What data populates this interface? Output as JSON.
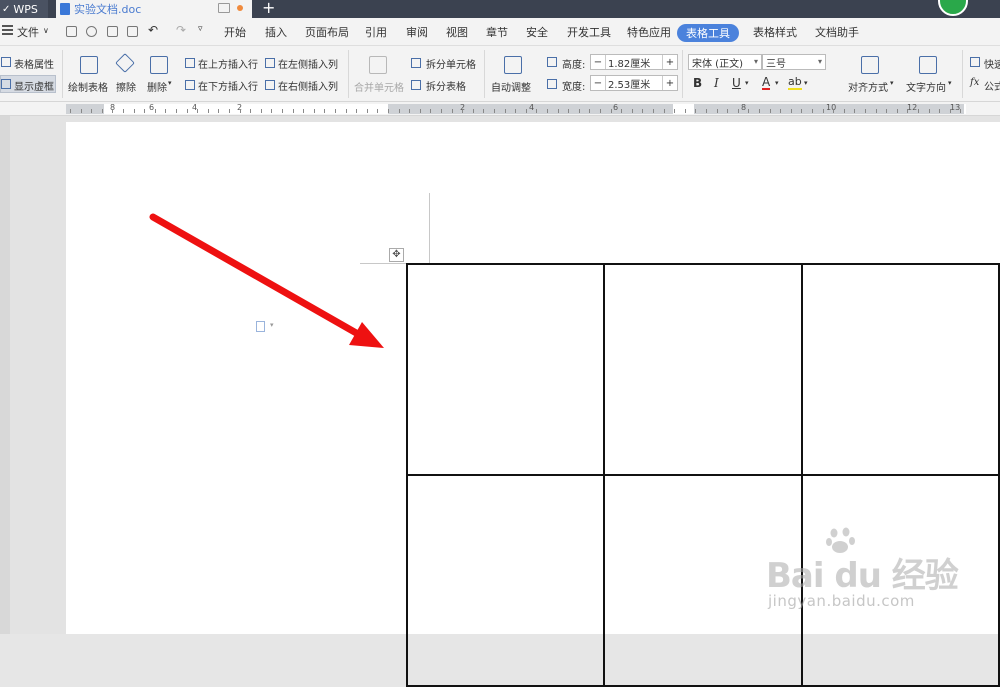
{
  "titlebar": {
    "app_tab": "WPS",
    "doc_tab": "实验文档.doc",
    "new_tab": "+"
  },
  "menu": {
    "file": "文件",
    "items": [
      "开始",
      "插入",
      "页面布局",
      "引用",
      "审阅",
      "视图",
      "章节",
      "安全",
      "开发工具",
      "特色应用"
    ],
    "active": "表格工具",
    "after": [
      "表格样式",
      "文档助手"
    ]
  },
  "ribbon": {
    "table_props": "表格属性",
    "show_border": "显示虚框",
    "draw_table": "绘制表格",
    "erase": "擦除",
    "delete": "删除",
    "insert_above": "在上方插入行",
    "insert_below": "在下方插入行",
    "insert_left": "在左侧插入列",
    "insert_right": "在右侧插入列",
    "merge_cells": "合并单元格",
    "split_cells": "拆分单元格",
    "split_table": "拆分表格",
    "auto_fit": "自动调整",
    "height_label": "高度:",
    "height_value": "1.82厘米",
    "width_label": "宽度:",
    "width_value": "2.53厘米",
    "font_name": "宋体 (正文)",
    "font_size": "三号",
    "bold": "B",
    "italic": "I",
    "underline": "U",
    "font_color": "A",
    "highlight": "ab",
    "align": "对齐方式",
    "text_direction": "文字方向",
    "quick_calc": "快速",
    "formula": "公式",
    "minus": "−",
    "plus": "+"
  },
  "ruler": {
    "numbers": [
      "8",
      "6",
      "4",
      "2",
      "2",
      "4",
      "6",
      "8",
      "10",
      "12",
      "13"
    ]
  },
  "table": {
    "rows": 2,
    "cols": 3,
    "cells": [
      [
        "",
        "",
        ""
      ],
      [
        "",
        "",
        ""
      ]
    ]
  },
  "watermark": {
    "logo": "Bai  du 经验",
    "url": "jingyan.baidu.com"
  },
  "colors": {
    "accent": "#4b82dc",
    "arrow": "#ee1111",
    "titlebar": "#3b4250"
  },
  "icons": [
    "shield-v-icon",
    "word-doc-icon",
    "monitor-icon",
    "save-icon",
    "print-icon",
    "undo-icon",
    "redo-icon",
    "move-handle-icon",
    "paragraph-icon"
  ]
}
